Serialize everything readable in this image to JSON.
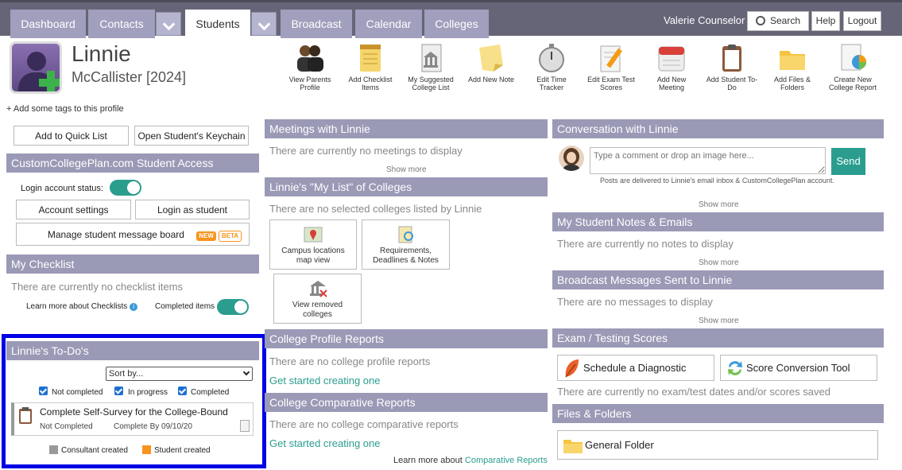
{
  "nav": {
    "tabs": [
      "Dashboard",
      "Contacts",
      "Students",
      "Broadcast",
      "Calendar",
      "Colleges"
    ],
    "active_tab": "Students",
    "user": "Valerie Counselor",
    "search_label": "Search",
    "help_label": "Help",
    "logout_label": "Logout"
  },
  "student": {
    "first_name": "Linnie",
    "last_name": "McCallister [2024]",
    "add_tags": "+ Add some tags to this profile"
  },
  "toolbar": [
    {
      "label": "View Parents Profile",
      "icon": "parents-icon"
    },
    {
      "label": "Add Checklist Items",
      "icon": "notepad-icon"
    },
    {
      "label": "My Suggested College List",
      "icon": "college-list-icon"
    },
    {
      "label": "Add New Note",
      "icon": "sticky-note-icon"
    },
    {
      "label": "Edit Time Tracker",
      "icon": "stopwatch-icon"
    },
    {
      "label": "Edit Exam Test Scores",
      "icon": "exam-edit-icon"
    },
    {
      "label": "Add New Meeting",
      "icon": "calendar-icon"
    },
    {
      "label": "Add Student To-Do",
      "icon": "clipboard-icon"
    },
    {
      "label": "Add Files & Folders",
      "icon": "folder-icon"
    },
    {
      "label": "Create New College Report",
      "icon": "report-icon"
    }
  ],
  "left": {
    "quick_list": "Add to Quick List",
    "keychain": "Open Student's Keychain",
    "access_header": "CustomCollegePlan.com Student Access",
    "login_status": "Login account status:",
    "account_settings": "Account settings",
    "login_as": "Login as student",
    "message_board": "Manage student message board",
    "badge_new": "NEW",
    "badge_beta": "BETA",
    "checklist_header": "My Checklist",
    "checklist_empty": "There are currently no checklist items",
    "learn_checklists": "Learn more about Checklists",
    "completed_items": "Completed items",
    "todo_header": "Linnie's To-Do's",
    "sort_by": "Sort by...",
    "filters": [
      "Not completed",
      "In progress",
      "Completed"
    ],
    "todo_item": {
      "title": "Complete Self-Survey for the College-Bound",
      "status": "Not Completed",
      "due": "Complete By 09/10/20"
    },
    "legend_consultant": "Consultant created",
    "legend_student": "Student created",
    "legend_consultant_color": "#999999",
    "legend_student_color": "#f7941d"
  },
  "middle": {
    "meetings_header": "Meetings with Linnie",
    "meetings_empty": "There are currently no meetings to display",
    "show_more": "Show more",
    "mylist_header": "Linnie's \"My List\" of Colleges",
    "mylist_empty": "There are no selected colleges listed by Linnie",
    "tile_campus": "Campus locations map view",
    "tile_requirements": "Requirements, Deadlines & Notes",
    "tile_removed": "View removed colleges",
    "profile_reports_header": "College Profile Reports",
    "profile_reports_empty": "There are no college profile reports",
    "get_started": "Get started creating one",
    "comparative_header": "College Comparative Reports",
    "comparative_empty": "There are no college comparative reports",
    "learn_more_prefix": "Learn more about",
    "learn_more_link": "Comparative Reports"
  },
  "right": {
    "conversation_header": "Conversation with Linnie",
    "comment_placeholder": "Type a comment or drop an image here...",
    "send": "Send",
    "delivered_note": "Posts are delivered to Linnie's email inbox & CustomCollegePlan account.",
    "show_more": "Show more",
    "notes_header": "My Student Notes & Emails",
    "notes_empty": "There are currently no notes to display",
    "broadcast_header": "Broadcast Messages Sent to Linnie",
    "broadcast_empty": "There are no messages to display",
    "exam_header": "Exam / Testing Scores",
    "schedule_diag": "Schedule a Diagnostic",
    "score_tool": "Score Conversion Tool",
    "exam_empty": "There are currently no exam/test dates and/or scores saved",
    "files_header": "Files & Folders",
    "general_folder": "General Folder"
  },
  "colors": {
    "accent": "#2a9d8f",
    "header": "#9a99b6",
    "nav": "#666578",
    "highlight_border": "#0000e6"
  }
}
